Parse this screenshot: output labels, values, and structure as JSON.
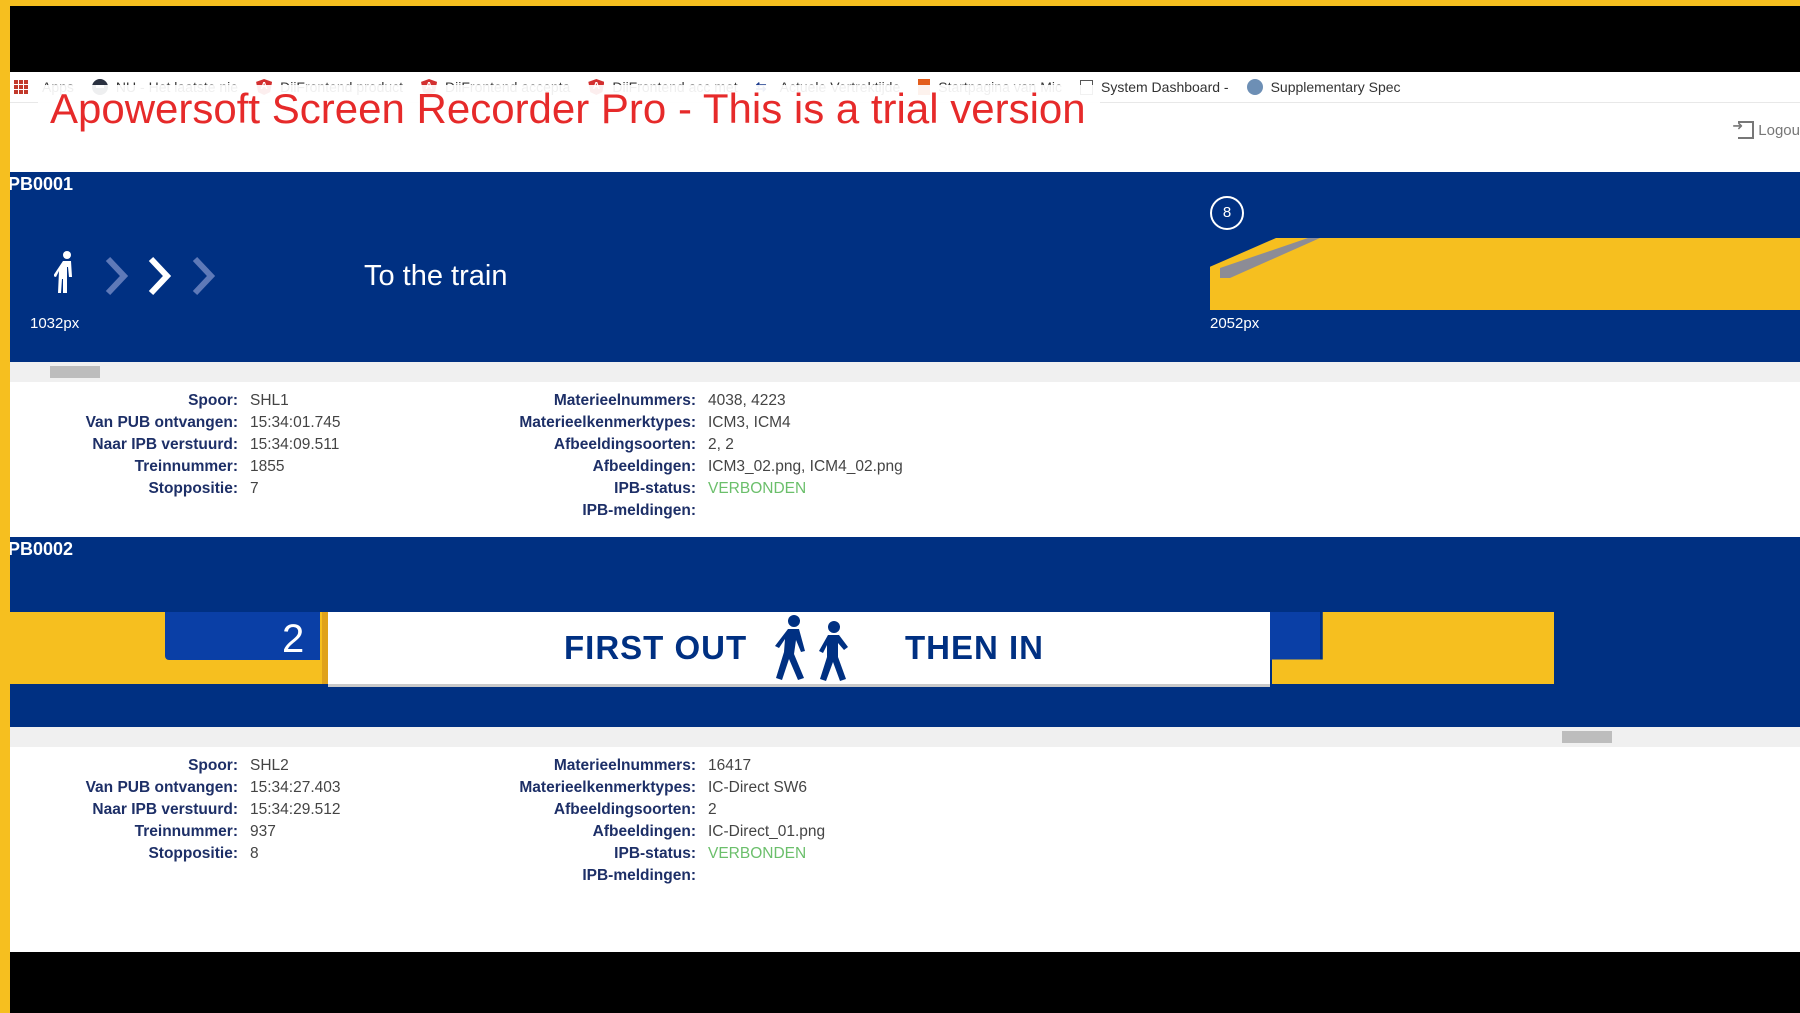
{
  "bookmarks": [
    {
      "label": "Apps",
      "icon": "apps-grid-icon"
    },
    {
      "label": "NU - Het laatste nie",
      "icon": "nu-icon"
    },
    {
      "label": "DiiFrontend product",
      "icon": "angular-icon"
    },
    {
      "label": "DiiFrontend accepta",
      "icon": "angular-icon"
    },
    {
      "label": "DiiFrontend acc met",
      "icon": "angular-icon"
    },
    {
      "label": "Actuele Vertrektijde",
      "icon": "ns-icon"
    },
    {
      "label": "Startpagina van Mic",
      "icon": "office-icon"
    },
    {
      "label": "System Dashboard -",
      "icon": "document-icon"
    },
    {
      "label": "Supplementary Spec",
      "icon": "globe-icon"
    }
  ],
  "watermark": "Apowersoft Screen Recorder Pro - This is a trial version",
  "header": {
    "logout_label": "Logou"
  },
  "boards": [
    {
      "id": "PB0001",
      "heading": "To the train",
      "left_px": "1032px",
      "right_px": "2052px",
      "coach_number": "8",
      "left_fields": [
        {
          "label": "Spoor:",
          "value": "SHL1"
        },
        {
          "label": "Van PUB ontvangen:",
          "value": "15:34:01.745"
        },
        {
          "label": "Naar IPB verstuurd:",
          "value": "15:34:09.511"
        },
        {
          "label": "Treinnummer:",
          "value": "1855"
        },
        {
          "label": "Stoppositie:",
          "value": "7"
        }
      ],
      "right_fields": [
        {
          "label": "Materieelnummers:",
          "value": "4038, 4223"
        },
        {
          "label": "Materieelkenmerktypes:",
          "value": "ICM3, ICM4"
        },
        {
          "label": "Afbeeldingsoorten:",
          "value": "2, 2"
        },
        {
          "label": "Afbeeldingen:",
          "value": "ICM3_02.png, ICM4_02.png"
        },
        {
          "label": "IPB-status:",
          "value": "VERBONDEN"
        },
        {
          "label": "IPB-meldingen:",
          "value": ""
        }
      ]
    },
    {
      "id": "PB0002",
      "coach_number": "2",
      "first_text": "FIRST OUT",
      "then_text": "THEN IN",
      "left_fields": [
        {
          "label": "Spoor:",
          "value": "SHL2"
        },
        {
          "label": "Van PUB ontvangen:",
          "value": "15:34:27.403"
        },
        {
          "label": "Naar IPB verstuurd:",
          "value": "15:34:29.512"
        },
        {
          "label": "Treinnummer:",
          "value": "937"
        },
        {
          "label": "Stoppositie:",
          "value": "8"
        }
      ],
      "right_fields": [
        {
          "label": "Materieelnummers:",
          "value": "16417"
        },
        {
          "label": "Materieelkenmerktypes:",
          "value": "IC-Direct SW6"
        },
        {
          "label": "Afbeeldingsoorten:",
          "value": "2"
        },
        {
          "label": "Afbeeldingen:",
          "value": "IC-Direct_01.png"
        },
        {
          "label": "IPB-status:",
          "value": "VERBONDEN"
        },
        {
          "label": "IPB-meldingen:",
          "value": ""
        }
      ]
    }
  ],
  "colors": {
    "ns_blue": "#003082",
    "ns_yellow": "#f6bf1f",
    "status_ok": "#6bbf6b",
    "watermark_red": "#e62a2a"
  }
}
